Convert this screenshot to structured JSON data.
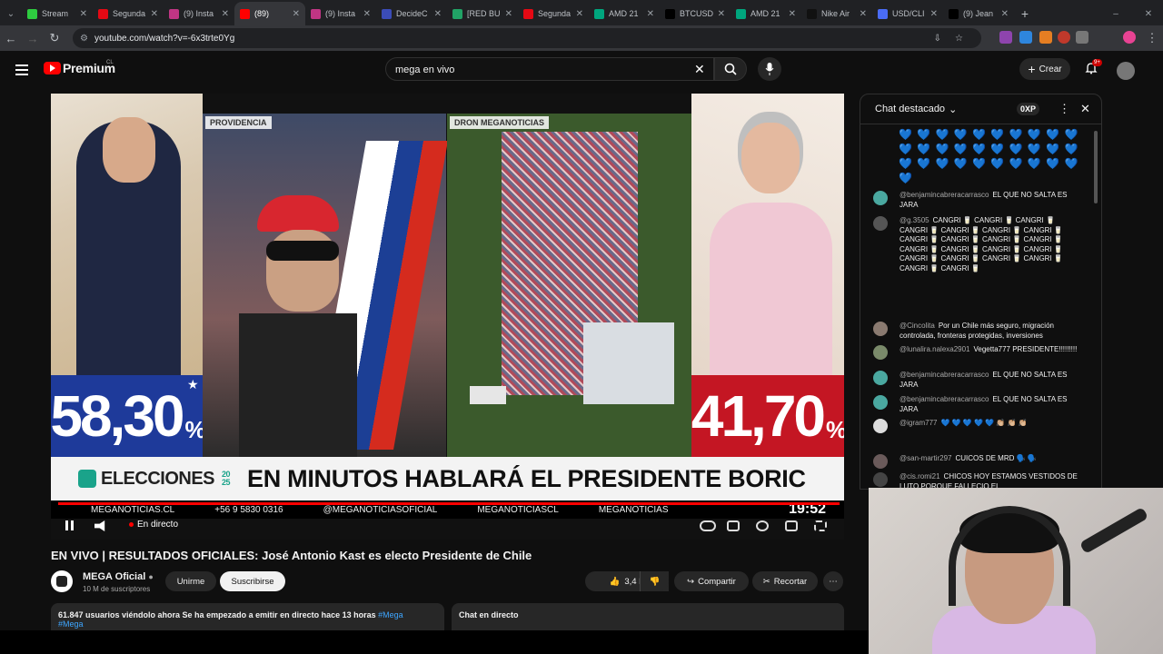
{
  "browser": {
    "tabs": [
      {
        "label": "Stream",
        "color": "#2ecc40"
      },
      {
        "label": "Segunda",
        "color": "#e50914"
      },
      {
        "label": "(9) Insta",
        "color": "#c13584"
      },
      {
        "label": "(89)",
        "color": "#ff0000"
      },
      {
        "label": "(9) Insta",
        "color": "#c13584"
      },
      {
        "label": "DecideC",
        "color": "#3b4cb8"
      },
      {
        "label": "[RED BU",
        "color": "#21a366"
      },
      {
        "label": "Segunda",
        "color": "#e50914"
      },
      {
        "label": "AMD 21",
        "color": "#00a67e"
      },
      {
        "label": "BTCUSD",
        "color": "#000000"
      },
      {
        "label": "AMD 21",
        "color": "#00a67e"
      },
      {
        "label": "Nike Air",
        "color": "#111111"
      },
      {
        "label": "USD/CLI",
        "color": "#4a6cf7"
      },
      {
        "label": "(9) Jean",
        "color": "#000000"
      }
    ],
    "new_tab": "+",
    "url": "youtube.com/watch?v=-6x3trte0Yg"
  },
  "youtube": {
    "logo": "Premium",
    "region": "CL",
    "search_value": "mega en vivo",
    "create_label": "Crear",
    "notif_badge": "9+"
  },
  "video": {
    "cand_left_pct": "58,30",
    "cand_right_pct": "41,70",
    "pct_sign": "%",
    "label_providencia": "PROVIDENCIA",
    "label_dron": "DRON MEGANOTICIAS",
    "elecciones": "ELECCIONES",
    "year_top": "20",
    "year_bottom": "25",
    "headline": "EN MINUTOS HABLARÁ EL PRESIDENTE BORIC",
    "ticker": [
      "MEGANOTICIAS.CL",
      "+56 9 5830 0316",
      "@MEGANOTICIASOFICIAL",
      "MEGANOTICIASCL",
      "MEGANOTICIAS"
    ],
    "clock": "19:52",
    "live_label": "En directo",
    "live_fraction": 1.0
  },
  "meta": {
    "title": "EN VIVO | RESULTADOS OFICIALES: José Antonio Kast es electo Presidente de Chile",
    "channel": "MEGA Oficial",
    "subscribers": "10 M de suscriptores",
    "join": "Unirme",
    "subscribe": "Suscribirse",
    "likes": "3,4 K",
    "share": "Compartir",
    "clip": "Recortar",
    "description_stats": "61.847 usuarios viéndolo ahora  Se ha empezado a emitir en directo hace 13 horas",
    "description_tag": "#Mega",
    "description_tag2": "#Mega",
    "chat_live": "Chat en directo"
  },
  "chat": {
    "header": "Chat destacado",
    "xp": "0XP",
    "messages": [
      {
        "author": "@benjamincabreracarrasco",
        "text": "EL QUE NO SALTA ES JARA",
        "avatar_color": "#4aa8a0"
      },
      {
        "author": "@g.3505",
        "text": "CANGRI 🥛 CANGRI 🥛 CANGRI 🥛 CANGRI 🥛 CANGRI 🥛 CANGRI 🥛 CANGRI 🥛 CANGRI 🥛 CANGRI 🥛 CANGRI 🥛 CANGRI 🥛 CANGRI 🥛 CANGRI 🥛 CANGRI 🥛 CANGRI 🥛 CANGRI 🥛 CANGRI 🥛 CANGRI 🥛 CANGRI 🥛 CANGRI 🥛 CANGRI 🥛",
        "avatar_color": "#555555"
      },
      {
        "author": "@Cincolita",
        "text": "Por un Chile más seguro, migración controlada, fronteras protegidas, inversiones",
        "avatar_color": "#8a7a70"
      },
      {
        "author": "@lunalira.nalexa2901",
        "text": "Vegetta777 PRESIDENTE!!!!!!!!!",
        "avatar_color": "#7a8a6a"
      },
      {
        "author": "@benjamincabreracarrasco",
        "text": "EL QUE NO SALTA ES JARA",
        "avatar_color": "#4aa8a0"
      },
      {
        "author": "@benjamincabreracarrasco",
        "text": "EL QUE NO SALTA ES JARA",
        "avatar_color": "#4aa8a0"
      },
      {
        "author": "@igram777",
        "text": "💙 💙 💙 💙 💙 👏🏼 👏🏼 👏🏼",
        "avatar_color": "#dddddd"
      },
      {
        "author": "@san-martir297",
        "text": "CUICOS DE MRD 🗣️ 🗣️",
        "avatar_color": "#6a5a5a"
      },
      {
        "author": "@cis.romi21",
        "text": "CHICOS HOY ESTAMOS VESTIDOS DE LUTO PORQUE FALLECIO EL",
        "avatar_color": "#444444"
      }
    ],
    "hearts": "💙 💙 💙 💙 💙 💙 💙 💙 💙 💙 💙 💙 💙 💙 💙 💙 💙 💙 💙 💙 💙 💙 💙 💙 💙 💙 💙 💙 💙 💙 💙"
  }
}
